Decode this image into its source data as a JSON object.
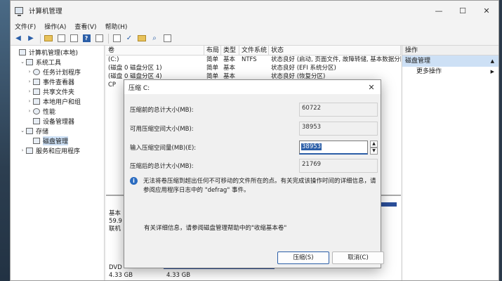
{
  "window": {
    "title": "计算机管理",
    "controls": {
      "minimize": "—",
      "maximize": "☐",
      "close": "✕"
    }
  },
  "menu": [
    "文件(F)",
    "操作(A)",
    "查看(V)",
    "帮助(H)"
  ],
  "tree": [
    {
      "label": "计算机管理(本地)",
      "chev": "",
      "indent": 0
    },
    {
      "label": "系统工具",
      "chev": "⌄",
      "indent": 1
    },
    {
      "label": "任务计划程序",
      "chev": "›",
      "indent": 2
    },
    {
      "label": "事件查看器",
      "chev": "›",
      "indent": 2
    },
    {
      "label": "共享文件夹",
      "chev": "›",
      "indent": 2
    },
    {
      "label": "本地用户和组",
      "chev": "›",
      "indent": 2
    },
    {
      "label": "性能",
      "chev": "›",
      "indent": 2
    },
    {
      "label": "设备管理器",
      "chev": "",
      "indent": 2
    },
    {
      "label": "存储",
      "chev": "⌄",
      "indent": 1
    },
    {
      "label": "磁盘管理",
      "chev": "",
      "indent": 2,
      "selected": true
    },
    {
      "label": "服务和应用程序",
      "chev": "›",
      "indent": 1
    }
  ],
  "columns": {
    "volume": "卷",
    "layout": "布局",
    "type": "类型",
    "fs": "文件系统",
    "status": "状态"
  },
  "volumes": [
    {
      "volume": "(C:)",
      "layout": "简单",
      "type": "基本",
      "fs": "NTFS",
      "status": "状态良好 (启动, 页面文件, 故障转储, 基本数据分区)"
    },
    {
      "volume": "(磁盘 0 磁盘分区 1)",
      "layout": "简单",
      "type": "基本",
      "fs": "",
      "status": "状态良好 (EFI 系统分区)"
    },
    {
      "volume": "(磁盘 0 磁盘分区 4)",
      "layout": "简单",
      "type": "基本",
      "fs": "",
      "status": "状态良好 (恢复分区)"
    },
    {
      "volume": "CP",
      "layout": "",
      "type": "",
      "fs": "",
      "status": ""
    }
  ],
  "lower": {
    "disk0": [
      "基本",
      "59.9",
      "联机"
    ],
    "dvd": [
      "DVD",
      "4.33 GB"
    ],
    "dvd_part": "4.33 GB"
  },
  "actions": {
    "header": "操作",
    "selected": "磁盘管理",
    "more": "更多操作",
    "arrow_up": "▲",
    "arrow_right": "▶"
  },
  "dialog": {
    "title": "压缩 C:",
    "close": "✕",
    "fields": [
      {
        "label": "压缩前的总计大小(MB):",
        "value": "60722"
      },
      {
        "label": "可用压缩空间大小(MB):",
        "value": "38953"
      },
      {
        "label": "输入压缩空间量(MB)(E):",
        "value": "38953"
      },
      {
        "label": "压缩后的总计大小(MB):",
        "value": "21769"
      }
    ],
    "info_icon": "i",
    "info_text": "无法将卷压缩到超出任何不可移动的文件所在的点。有关完成该操作时间的详细信息，请参阅应用程序日志中的 \"defrag\" 事件。",
    "help_text": "有关详细信息，请参阅磁盘管理帮助中的\"收缩基本卷\"",
    "ok": "压缩(S)",
    "cancel": "取消(C)"
  }
}
